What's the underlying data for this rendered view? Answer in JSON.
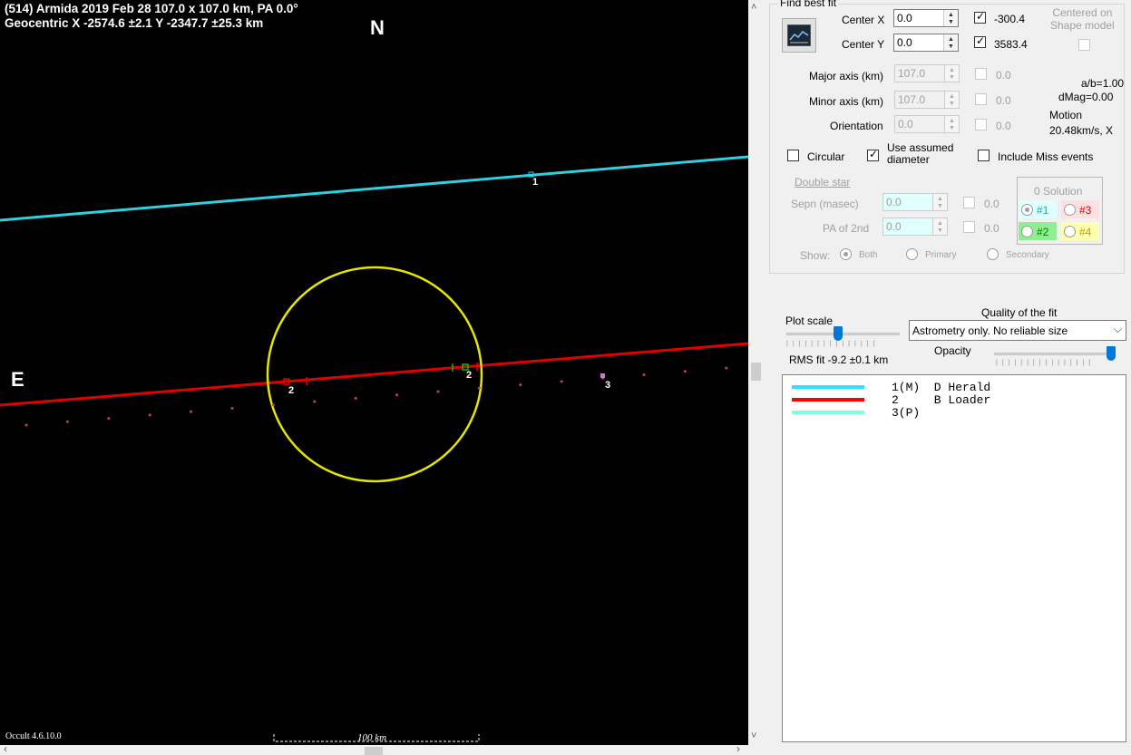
{
  "plot": {
    "title_line1": "(514) Armida  2019 Feb 28  107.0 x 107.0 km, PA 0.0°",
    "title_line2": "Geocentric  X  -2574.6 ±2.1  Y -2347.7 ±25.3 km",
    "north_label": "N",
    "east_label": "E",
    "chord_labels": [
      "1",
      "2",
      "2",
      "3"
    ],
    "version": "Occult 4.6.10.0",
    "scale_label": "100 km",
    "colors": {
      "background": "#000000",
      "ellipse": "#e5e500",
      "chord_1": "#30d0e0",
      "chord_2": "#e00000",
      "path_dots": "#c04060",
      "miss_marker": "#c080c0"
    }
  },
  "panel": {
    "find_best_fit_label": "Find best fit",
    "center_x_label": "Center X",
    "center_x_value": "0.0",
    "center_x_fit": "-300.4",
    "center_y_label": "Center Y",
    "center_y_value": "0.0",
    "center_y_fit": "3583.4",
    "centered_on_label": "Centered on\nShape model",
    "major_axis_label": "Major axis (km)",
    "major_axis_value": "107.0",
    "major_axis_fit": "0.0",
    "minor_axis_label": "Minor axis (km)",
    "minor_axis_value": "107.0",
    "minor_axis_fit": "0.0",
    "orientation_label": "Orientation",
    "orientation_value": "0.0",
    "orientation_fit": "0.0",
    "ab_ratio": "a/b=1.00",
    "dmag": "dMag=0.00",
    "motion_label": "Motion",
    "motion_value": "20.48km/s, X",
    "circular_label": "Circular",
    "use_assumed_label": "Use assumed\ndiameter",
    "include_miss_label": "Include Miss events",
    "double_star_label": "Double star",
    "sepn_label": "Sepn (masec)",
    "sepn_value": "0.0",
    "sepn_fit": "0.0",
    "pa2_label": "PA of 2nd",
    "pa2_value": "0.0",
    "pa2_fit": "0.0",
    "show_label": "Show:",
    "show_options": [
      "Both",
      "Primary",
      "Secondary"
    ],
    "solution_label": "0 Solution",
    "solutions": [
      "#1",
      "#3",
      "#2",
      "#4"
    ],
    "plot_scale_label": "Plot scale",
    "quality_label": "Quality of the fit",
    "quality_value": "Astrometry only. No reliable size",
    "opacity_label": "Opacity",
    "rms_fit": "RMS fit -9.2 ±0.1 km",
    "plot_scale_level": 0.45,
    "opacity_level": 1.0
  },
  "legend": [
    {
      "text": "1(M)  D Herald",
      "color": "#30e0ff"
    },
    {
      "text": "2     B Loader",
      "color": "#ff0000"
    },
    {
      "text": "3(P)",
      "color": "#80ffe0"
    }
  ]
}
